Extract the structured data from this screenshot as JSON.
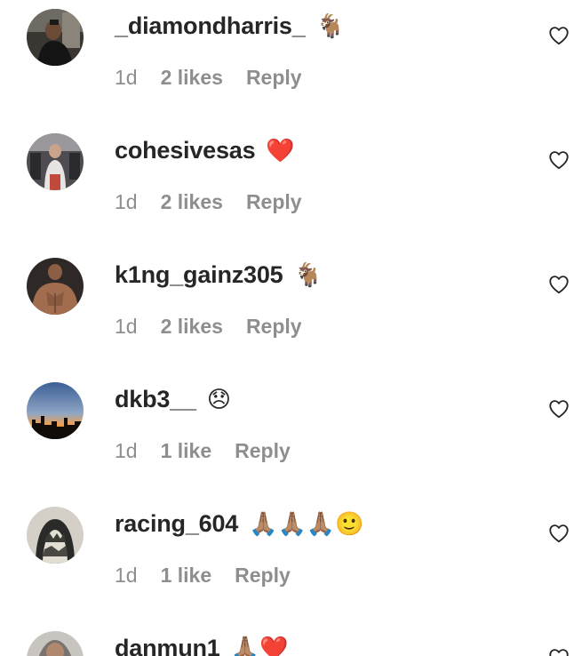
{
  "comments": [
    {
      "username": "_diamondharris_",
      "text": "🐐",
      "time": "1d",
      "likes": "2 likes",
      "reply_label": "Reply"
    },
    {
      "username": "cohesivesas",
      "text": "❤️",
      "time": "1d",
      "likes": "2 likes",
      "reply_label": "Reply"
    },
    {
      "username": "k1ng_gainz305",
      "text": "🐐",
      "time": "1d",
      "likes": "2 likes",
      "reply_label": "Reply"
    },
    {
      "username": "dkb3__",
      "text": "😞",
      "time": "1d",
      "likes": "1 like",
      "reply_label": "Reply"
    },
    {
      "username": "racing_604",
      "text": "🙏🏽🙏🏽🙏🏽🙂",
      "time": "1d",
      "likes": "1 like",
      "reply_label": "Reply"
    },
    {
      "username": "danmun1",
      "text": "🙏🏽❤️",
      "time": "",
      "likes": "",
      "reply_label": ""
    }
  ],
  "colors": {
    "username": "#262626",
    "meta": "#8e8e8e",
    "heart_outline": "#262626"
  },
  "icons": {
    "like": "heart-outline-icon"
  }
}
